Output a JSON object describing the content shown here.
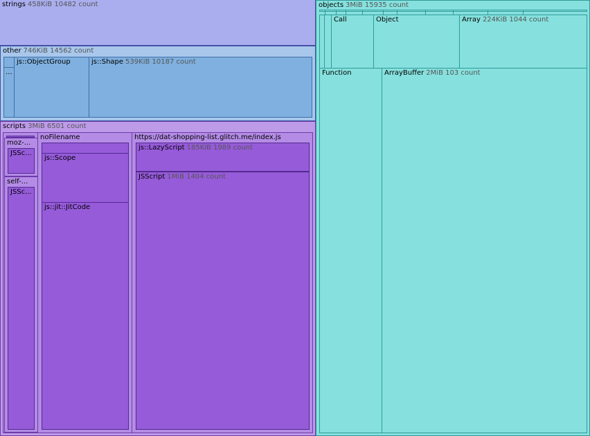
{
  "strings": {
    "name": "strings",
    "meta": "458KiB 10482 count"
  },
  "other": {
    "name": "other",
    "meta": "746KiB 14562 count",
    "small_label": "...",
    "object_group": {
      "name": "js::ObjectGroup"
    },
    "shape": {
      "name": "js::Shape",
      "meta": "539KiB 10187 count"
    }
  },
  "scripts": {
    "name": "scripts",
    "meta": "3MiB 6501 count",
    "moz": {
      "name": "moz-...",
      "child": "JSSc..."
    },
    "self": {
      "name": "self-...",
      "child": "JSSc..."
    },
    "nofilename": {
      "name": "noFilename",
      "scope": "js::Scope",
      "jitcode": "js::jit::JitCode"
    },
    "url": {
      "name": "https://dat-shopping-list.glitch.me/index.js",
      "lazyscript": {
        "name": "js::LazyScript",
        "meta": "185KiB 1989 count"
      },
      "jsscript": {
        "name": "JSScript",
        "meta": "1MiB 1404 count"
      }
    }
  },
  "objects": {
    "name": "objects",
    "meta": "3MiB 15935 count",
    "call": {
      "name": "Call"
    },
    "object": {
      "name": "Object"
    },
    "array": {
      "name": "Array",
      "meta": "224KiB 1044 count"
    },
    "function": {
      "name": "Function"
    },
    "arraybuffer": {
      "name": "ArrayBuffer",
      "meta": "2MiB 103 count"
    }
  }
}
